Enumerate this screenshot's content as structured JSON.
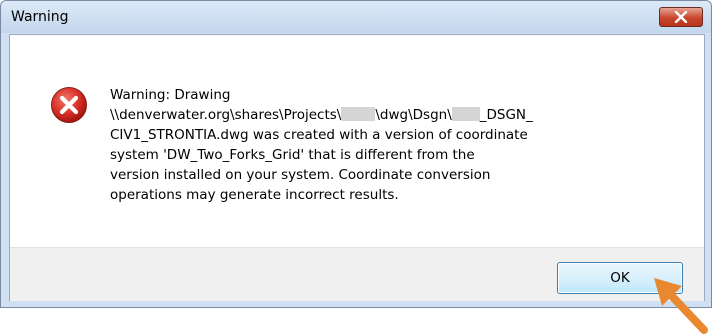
{
  "window": {
    "title": "Warning",
    "close_label": "close"
  },
  "message": {
    "line1": "Warning: Drawing",
    "line2_a": "\\\\denverwater.org\\shares\\Projects\\",
    "line2_b": "\\dwg\\Dsgn\\",
    "line2_c": "_DSGN_",
    "line3": "CIV1_STRONTIA.dwg was created with a version of coordinate",
    "line4": "system 'DW_Two_Forks_Grid' that is different from the",
    "line5": "version installed on your system.  Coordinate conversion",
    "line6": "operations may generate incorrect results."
  },
  "buttons": {
    "ok_label": "OK"
  },
  "icons": {
    "error": "error-icon",
    "close": "close-x-icon",
    "pointer": "arrow-pointer-icon"
  },
  "colors": {
    "error_red": "#d8302a",
    "close_red": "#c8462e",
    "arrow_orange": "#e8892f",
    "focus_blue": "#3c7fb1"
  }
}
